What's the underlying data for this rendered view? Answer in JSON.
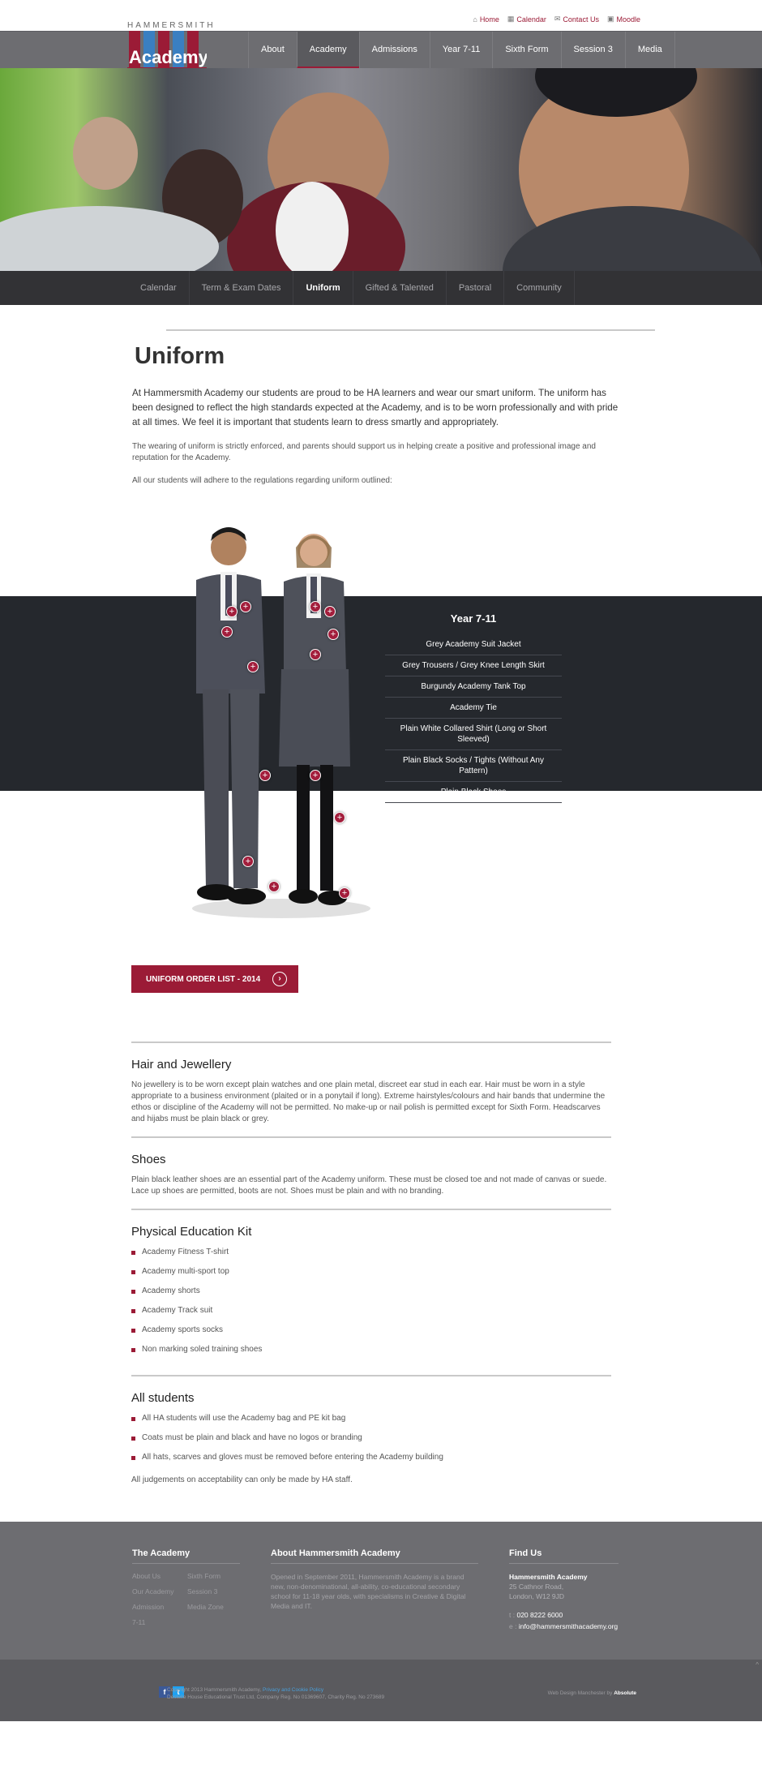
{
  "utility_nav": [
    {
      "icon": "home-icon",
      "label": "Home"
    },
    {
      "icon": "calendar-icon",
      "label": "Calendar"
    },
    {
      "icon": "mail-icon",
      "label": "Contact Us"
    },
    {
      "icon": "moodle-icon",
      "label": "Moodle"
    }
  ],
  "logo": {
    "top": "HAMMERSMITH",
    "word": "Academy"
  },
  "main_nav": [
    "About",
    "Academy",
    "Admissions",
    "Year 7-11",
    "Sixth Form",
    "Session 3",
    "Media"
  ],
  "sub_nav": [
    "Calendar",
    "Term & Exam Dates",
    "Uniform",
    "Gifted & Talented",
    "Pastoral",
    "Community"
  ],
  "page": {
    "title": "Uniform",
    "lead": "At Hammersmith Academy our students are proud to be HA learners and wear our smart uniform. The uniform has been designed to reflect the high standards expected at the Academy, and is to be worn professionally and with pride at all times. We feel it is important that students learn to dress smartly and appropriately.",
    "para1": "The wearing of uniform is strictly enforced, and parents should support us in helping create a positive and professional image and reputation for the Academy.",
    "para2": "All our students will adhere to the regulations regarding uniform outlined:"
  },
  "year_panel": {
    "title": "Year 7-11",
    "items": [
      "Grey Academy Suit Jacket",
      "Grey Trousers / Grey Knee Length Skirt",
      "Burgundy Academy Tank Top",
      "Academy Tie",
      "Plain White Collared Shirt (Long or Short Sleeved)",
      "Plain Black Socks / Tights (Without Any Pattern)",
      "Plain Black Shoes"
    ]
  },
  "order_button": "UNIFORM ORDER LIST - 2014",
  "sections": {
    "hair": {
      "title": "Hair and Jewellery",
      "text": "No jewellery is to be worn except plain watches and one plain metal, discreet ear stud in each ear. Hair must be worn in a style appropriate to a business environment (plaited or in a ponytail if long). Extreme hairstyles/colours and hair bands that undermine the ethos or discipline of the Academy will not be permitted. No make-up or nail polish is permitted except for Sixth Form. Headscarves and hijabs must be plain black or grey."
    },
    "shoes": {
      "title": "Shoes",
      "text": "Plain black leather shoes are an essential part of the Academy uniform. These must be closed toe and not made of canvas or suede. Lace up shoes are permitted, boots are not. Shoes must be plain and with no branding."
    },
    "pe": {
      "title": "Physical Education Kit",
      "items": [
        "Academy Fitness T-shirt",
        "Academy multi-sport top",
        "Academy shorts",
        "Academy Track suit",
        "Academy sports socks",
        "Non marking soled training shoes"
      ]
    },
    "all": {
      "title": "All students",
      "items": [
        "All HA students will use the Academy bag and PE kit bag",
        "Coats must be plain and black and have no logos or branding",
        "All hats, scarves and gloves must be removed before entering the Academy building"
      ],
      "note": "All judgements on acceptability can only be made by HA staff."
    }
  },
  "footer": {
    "col1": {
      "title": "The Academy",
      "links": [
        "About Us",
        "Sixth Form",
        "Our Academy",
        "Session 3",
        "Admission",
        "Media Zone",
        "7-11"
      ]
    },
    "col2": {
      "title": "About Hammersmith Academy",
      "text": "Opened in September 2011, Hammersmith Academy is a brand new, non-denominational, all-ability, co-educational secondary school for 11-18 year olds, with specialisms in Creative & Digital Media and IT."
    },
    "col3": {
      "title": "Find Us",
      "name": "Hammersmith Academy",
      "addr1": "25 Cathnor Road,",
      "addr2": "London, W12 9JD",
      "tel_label": "t :",
      "tel": "020 8222 6000",
      "email_label": "e :",
      "email": "info@hammersmithacademy.org"
    }
  },
  "bottom": {
    "copy1": "Copyright 2013 Hammersmith Academy,",
    "policy": "Privacy and Cookie Policy",
    "copy2": "Desteile House Educational Trust Ltd, Company Reg. No 01369607, Charity Reg. No 273689",
    "credit_prefix": "Web Design Manchester by",
    "credit_name": "Absolute"
  },
  "colors": {
    "brand": "#9b1b36",
    "nav": "#6d6d71",
    "subnav": "#323235",
    "band": "#25282d"
  }
}
